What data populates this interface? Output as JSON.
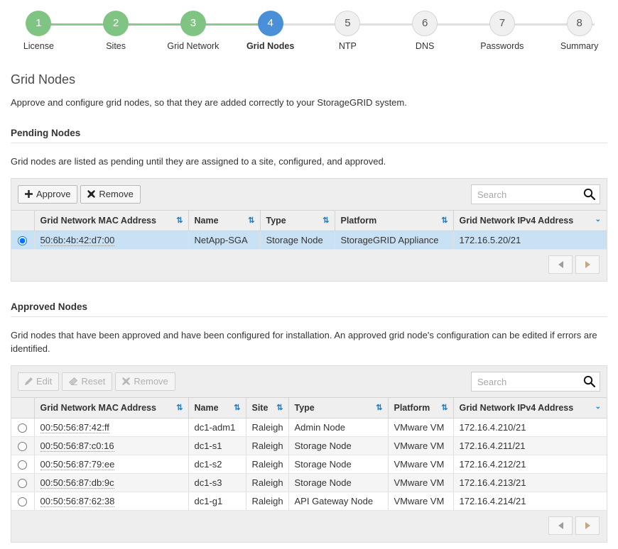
{
  "wizard": {
    "steps": [
      {
        "number": "1",
        "label": "License",
        "state": "done"
      },
      {
        "number": "2",
        "label": "Sites",
        "state": "done"
      },
      {
        "number": "3",
        "label": "Grid Network",
        "state": "done"
      },
      {
        "number": "4",
        "label": "Grid Nodes",
        "state": "current"
      },
      {
        "number": "5",
        "label": "NTP",
        "state": "todo"
      },
      {
        "number": "6",
        "label": "DNS",
        "state": "todo"
      },
      {
        "number": "7",
        "label": "Passwords",
        "state": "todo"
      },
      {
        "number": "8",
        "label": "Summary",
        "state": "todo"
      }
    ],
    "colors": {
      "done": "#7fc482",
      "current": "#4a90d9",
      "todo": "#f0f0f0",
      "track_done": "#8cc98f",
      "track": "#e0e0e0"
    }
  },
  "page": {
    "title": "Grid Nodes",
    "description": "Approve and configure grid nodes, so that they are added correctly to your StorageGRID system."
  },
  "pending": {
    "section_title": "Pending Nodes",
    "section_description": "Grid nodes are listed as pending until they are assigned to a site, configured, and approved.",
    "toolbar": {
      "approve_label": "Approve",
      "approve_icon": "plus-icon",
      "remove_label": "Remove",
      "remove_icon": "times-icon"
    },
    "search": {
      "placeholder": "Search",
      "value": "",
      "icon": "search-icon"
    },
    "columns": [
      {
        "label": "Grid Network MAC Address",
        "sort": "both"
      },
      {
        "label": "Name",
        "sort": "both"
      },
      {
        "label": "Type",
        "sort": "both"
      },
      {
        "label": "Platform",
        "sort": "both"
      },
      {
        "label": "Grid Network IPv4 Address",
        "sort": "desc"
      }
    ],
    "rows": [
      {
        "selected": true,
        "mac": "50:6b:4b:42:d7:00",
        "name": "NetApp-SGA",
        "type": "Storage Node",
        "platform": "StorageGRID Appliance",
        "ipv4": "172.16.5.20/21"
      }
    ],
    "pager": {
      "prev_icon": "triangle-left-icon",
      "next_icon": "triangle-right-icon"
    }
  },
  "approved": {
    "section_title": "Approved Nodes",
    "section_description": "Grid nodes that have been approved and have been configured for installation. An approved grid node's configuration can be edited if errors are identified.",
    "toolbar": {
      "edit_label": "Edit",
      "edit_icon": "pencil-icon",
      "edit_disabled": true,
      "reset_label": "Reset",
      "reset_icon": "eraser-icon",
      "reset_disabled": true,
      "remove_label": "Remove",
      "remove_icon": "times-icon",
      "remove_disabled": true
    },
    "search": {
      "placeholder": "Search",
      "value": "",
      "icon": "search-icon"
    },
    "columns": [
      {
        "label": "Grid Network MAC Address",
        "sort": "both"
      },
      {
        "label": "Name",
        "sort": "both"
      },
      {
        "label": "Site",
        "sort": "both"
      },
      {
        "label": "Type",
        "sort": "both"
      },
      {
        "label": "Platform",
        "sort": "both"
      },
      {
        "label": "Grid Network IPv4 Address",
        "sort": "desc"
      }
    ],
    "rows": [
      {
        "mac": "00:50:56:87:42:ff",
        "name": "dc1-adm1",
        "site": "Raleigh",
        "type": "Admin Node",
        "platform": "VMware VM",
        "ipv4": "172.16.4.210/21"
      },
      {
        "mac": "00:50:56:87:c0:16",
        "name": "dc1-s1",
        "site": "Raleigh",
        "type": "Storage Node",
        "platform": "VMware VM",
        "ipv4": "172.16.4.211/21"
      },
      {
        "mac": "00:50:56:87:79:ee",
        "name": "dc1-s2",
        "site": "Raleigh",
        "type": "Storage Node",
        "platform": "VMware VM",
        "ipv4": "172.16.4.212/21"
      },
      {
        "mac": "00:50:56:87:db:9c",
        "name": "dc1-s3",
        "site": "Raleigh",
        "type": "Storage Node",
        "platform": "VMware VM",
        "ipv4": "172.16.4.213/21"
      },
      {
        "mac": "00:50:56:87:62:38",
        "name": "dc1-g1",
        "site": "Raleigh",
        "type": "API Gateway Node",
        "platform": "VMware VM",
        "ipv4": "172.16.4.214/21"
      }
    ],
    "pager": {
      "prev_icon": "triangle-left-icon",
      "next_icon": "triangle-right-icon"
    }
  },
  "icons": {
    "sort_both": "⇅",
    "sort_desc": "⌄",
    "plus": "✚",
    "times": "✖",
    "pencil": "✎",
    "eraser": "◢"
  }
}
